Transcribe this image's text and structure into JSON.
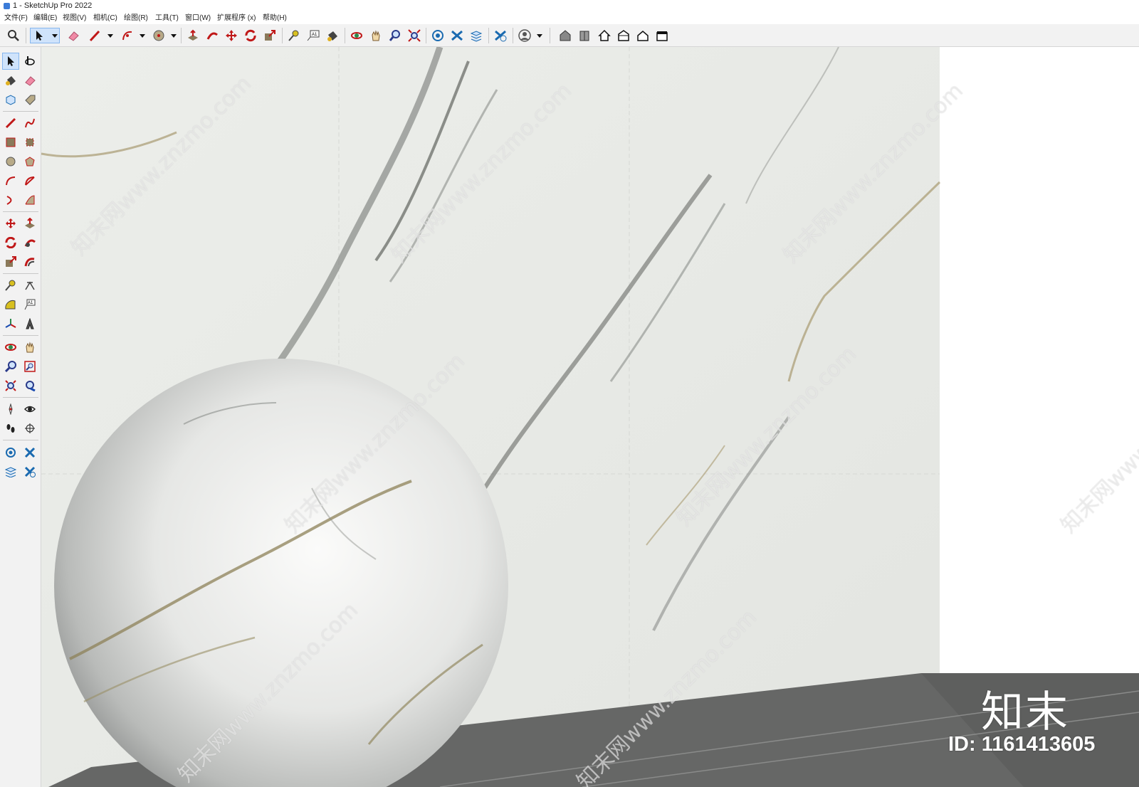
{
  "window": {
    "title": "1 - SketchUp Pro 2022"
  },
  "menu": [
    {
      "label": "文件(F)"
    },
    {
      "label": "编辑(E)"
    },
    {
      "label": "视图(V)"
    },
    {
      "label": "相机(C)"
    },
    {
      "label": "绘图(R)"
    },
    {
      "label": "工具(T)"
    },
    {
      "label": "窗口(W)"
    },
    {
      "label": "扩展程序 (x)"
    },
    {
      "label": "帮助(H)"
    }
  ],
  "toolbar_icons": [
    "search-icon",
    "select-icon",
    "eraser-icon",
    "pencil-icon",
    "arc-icon",
    "circle-icon",
    "push-pull-icon",
    "follow-me-icon",
    "move-icon",
    "rotate-icon",
    "scale-icon",
    "tape-measure-icon",
    "text-icon",
    "paint-bucket-icon",
    "orbit-icon",
    "pan-icon",
    "zoom-icon",
    "zoom-extents-icon",
    "sandbox-icon",
    "section-plane-icon",
    "layers-icon",
    "style-icon",
    "account-icon",
    "warehouse-icon",
    "component-icon",
    "house-icon",
    "iso-view-icon",
    "top-view-icon",
    "front-view-icon"
  ],
  "left_toolbar_icons": [
    "select-icon",
    "orbit-icon",
    "paint-bucket-icon",
    "eraser-icon",
    "component-icon",
    "tag-icon",
    "pencil-icon",
    "freehand-icon",
    "rectangle-icon",
    "rotated-rectangle-icon",
    "circle-icon",
    "polygon-icon",
    "arc-icon",
    "pie-icon",
    "two-point-arc-icon",
    "three-point-arc-icon",
    "move-icon",
    "push-pull-icon",
    "rotate-icon",
    "follow-me-icon",
    "scale-icon",
    "offset-icon",
    "tape-measure-icon",
    "dimension-icon",
    "protractor-icon",
    "text-icon",
    "axes-icon",
    "3d-text-icon",
    "orbit-icon",
    "pan-icon",
    "zoom-icon",
    "zoom-window-icon",
    "zoom-extents-icon",
    "previous-view-icon",
    "position-camera-icon",
    "look-around-icon",
    "walk-icon",
    "section-plane-icon",
    "sandbox-icon",
    "stamp-icon",
    "layers-icon",
    "drape-icon"
  ],
  "watermark": {
    "logo": "知末",
    "id": "ID: 1161413605",
    "repeat_text": "知末网www.znzmo.com"
  },
  "colors": {
    "toolbar_bg": "#f2f2f2",
    "active_tool": "#cfe3fb",
    "marble_base": "#e9ebe7",
    "floor": "#666766"
  }
}
